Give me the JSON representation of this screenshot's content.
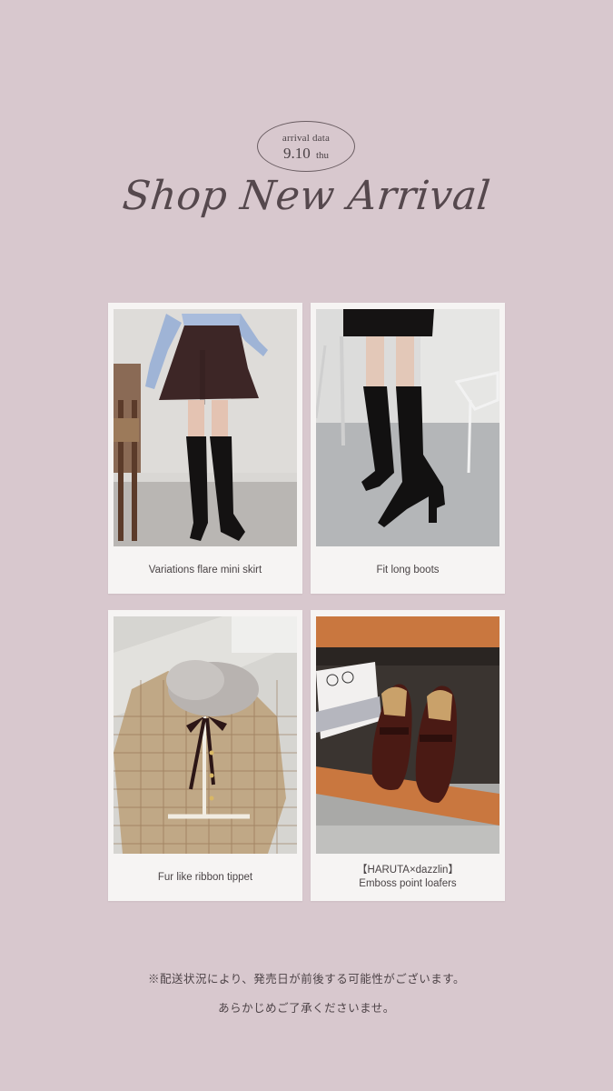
{
  "header": {
    "arrival_label": "arrival data",
    "date": "9.10",
    "weekday": "thu",
    "title": "Shop New Arrival"
  },
  "products": [
    {
      "caption_line1": "Variations flare mini skirt",
      "caption_line2": ""
    },
    {
      "caption_line1": "Fit long boots",
      "caption_line2": ""
    },
    {
      "caption_line1": "Fur like ribbon tippet",
      "caption_line2": ""
    },
    {
      "caption_line1": "【HARUTA×dazzlin】",
      "caption_line2": "Emboss point loafers"
    }
  ],
  "footer": {
    "note_line1": "※配送状況により、発売日が前後する可能性がございます。",
    "note_line2": "あらかじめご了承くださいませ。"
  },
  "colors": {
    "background": "#d8c8ce",
    "card": "#f6f4f3",
    "text": "#4a3f43"
  }
}
